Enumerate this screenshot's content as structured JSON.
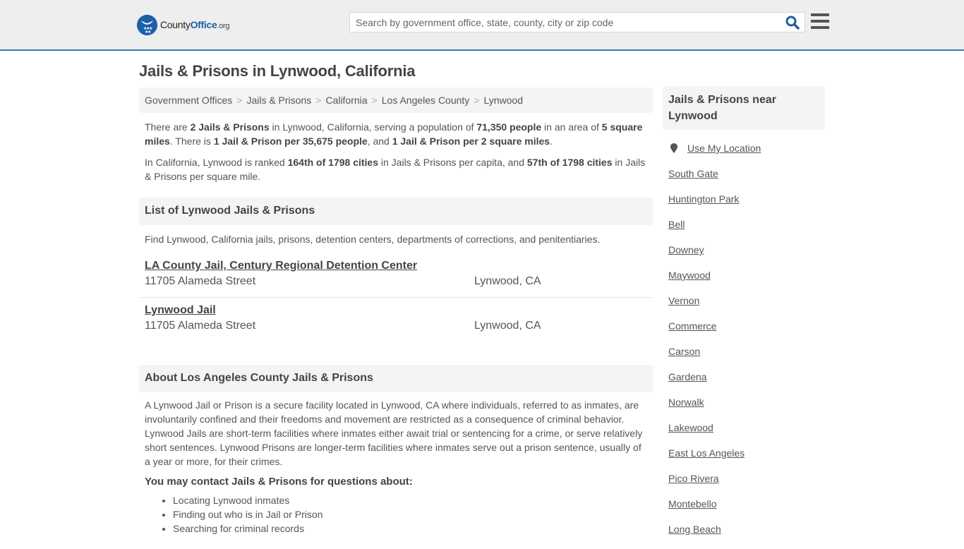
{
  "header": {
    "logo": {
      "county": "County",
      "office": "Office",
      "org": ".org"
    },
    "search": {
      "placeholder": "Search by government office, state, county, city or zip code",
      "value": ""
    },
    "icons": {
      "search": "search-icon",
      "menu": "hamburger-menu-icon",
      "logo": "eagle-stars-logo-icon"
    },
    "colors": {
      "brand": "#1d5fa8",
      "accent_border": "#3a7bb0"
    }
  },
  "page": {
    "title": "Jails & Prisons in Lynwood, California"
  },
  "breadcrumb": [
    {
      "label": "Government Offices"
    },
    {
      "label": "Jails & Prisons"
    },
    {
      "label": "California"
    },
    {
      "label": "Los Angeles County"
    },
    {
      "label": "Lynwood"
    }
  ],
  "breadcrumb_separator": ">",
  "intro": {
    "p1": {
      "t1": "There are ",
      "b1": "2 Jails & Prisons",
      "t2": " in Lynwood, California, serving a population of ",
      "b2": "71,350 people",
      "t3": " in an area of ",
      "b3": "5 square miles",
      "t4": ". There is ",
      "b4": "1 Jail & Prison per 35,675 people",
      "t5": ", and ",
      "b5": "1 Jail & Prison per 2 square miles",
      "t6": "."
    },
    "p2": {
      "t1": "In California, Lynwood is ranked ",
      "b1": "164th of 1798 cities",
      "t2": " in Jails & Prisons per capita, and ",
      "b2": "57th of 1798 cities",
      "t3": " in Jails & Prisons per square mile."
    }
  },
  "list_section": {
    "heading": "List of Lynwood Jails & Prisons",
    "description": "Find Lynwood, California jails, prisons, detention centers, departments of corrections, and penitentiaries.",
    "facilities": [
      {
        "name": "LA County Jail, Century Regional Detention Center",
        "street": "11705 Alameda Street",
        "city": "Lynwood, CA"
      },
      {
        "name": "Lynwood Jail",
        "street": "11705 Alameda Street",
        "city": "Lynwood, CA"
      }
    ]
  },
  "about_section": {
    "heading": "About Los Angeles County Jails & Prisons",
    "text": "A Lynwood Jail or Prison is a secure facility located in Lynwood, CA where individuals, referred to as inmates, are involuntarily confined and their freedoms and movement are restricted as a consequence of criminal behavior. Lynwood Jails are short-term facilities where inmates either await trial or sentencing for a crime, or serve relatively short sentences. Lynwood Prisons are longer-term facilities where inmates serve out a prison sentence, usually of a year or more, for their crimes.",
    "contact_heading": "You may contact Jails & Prisons for questions about:",
    "contact_items": [
      "Locating Lynwood inmates",
      "Finding out who is in Jail or Prison",
      "Searching for criminal records"
    ]
  },
  "sidebar": {
    "heading": "Jails & Prisons near Lynwood",
    "use_location": "Use My Location",
    "use_location_icon": "map-pin-icon",
    "nearby": [
      "South Gate",
      "Huntington Park",
      "Bell",
      "Downey",
      "Maywood",
      "Vernon",
      "Commerce",
      "Carson",
      "Gardena",
      "Norwalk",
      "Lakewood",
      "East Los Angeles",
      "Pico Rivera",
      "Montebello",
      "Long Beach"
    ]
  }
}
